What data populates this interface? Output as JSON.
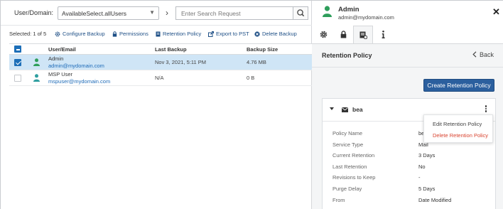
{
  "search": {
    "label": "User/Domain:",
    "select_value": "AvailableSelect.allUsers",
    "placeholder": "Enter Search Request"
  },
  "toolbar": {
    "selected": "Selected: 1 of 5",
    "actions": [
      "Configure Backup",
      "Permissions",
      "Retention Policy",
      "Export to PST",
      "Delete Backup"
    ]
  },
  "table": {
    "headers": [
      "User/Email",
      "Last Backup",
      "Backup Size"
    ],
    "rows": [
      {
        "name": "Admin",
        "email": "admin@mydomain.com",
        "last_backup": "Nov 3, 2021, 5:11 PM",
        "size": "4.76 MB",
        "selected": true
      },
      {
        "name": "MSP User",
        "email": "mspuser@mydomain.com",
        "last_backup": "N/A",
        "size": "0 B",
        "selected": false
      }
    ]
  },
  "panel": {
    "user_name": "Admin",
    "user_email": "admin@mydomain.com",
    "close_glyph": "✕",
    "tabs": [
      "settings-icon",
      "lock-icon",
      "policy-icon",
      "info-icon"
    ],
    "title": "Retention Policy",
    "back": "Back",
    "create_button": "Create Retention Policy",
    "policy": {
      "name": "bea",
      "properties": [
        {
          "key": "Policy Name",
          "value": "be"
        },
        {
          "key": "Service Type",
          "value": "Mail"
        },
        {
          "key": "Current Retention",
          "value": "3 Days"
        },
        {
          "key": "Last Retention",
          "value": "No"
        },
        {
          "key": "Revisions to Keep",
          "value": "-"
        },
        {
          "key": "Purge Delay",
          "value": "5 Days"
        },
        {
          "key": "From",
          "value": "Date Modified"
        }
      ]
    },
    "menu": {
      "edit": "Edit Retention Policy",
      "delete": "Delete Retention Policy"
    }
  },
  "colors": {
    "accent": "#2b5f9e",
    "link": "#1e4f86",
    "user_icon": "#2e9e5b",
    "selected_row": "#cfe5f6",
    "danger": "#d9432f"
  }
}
